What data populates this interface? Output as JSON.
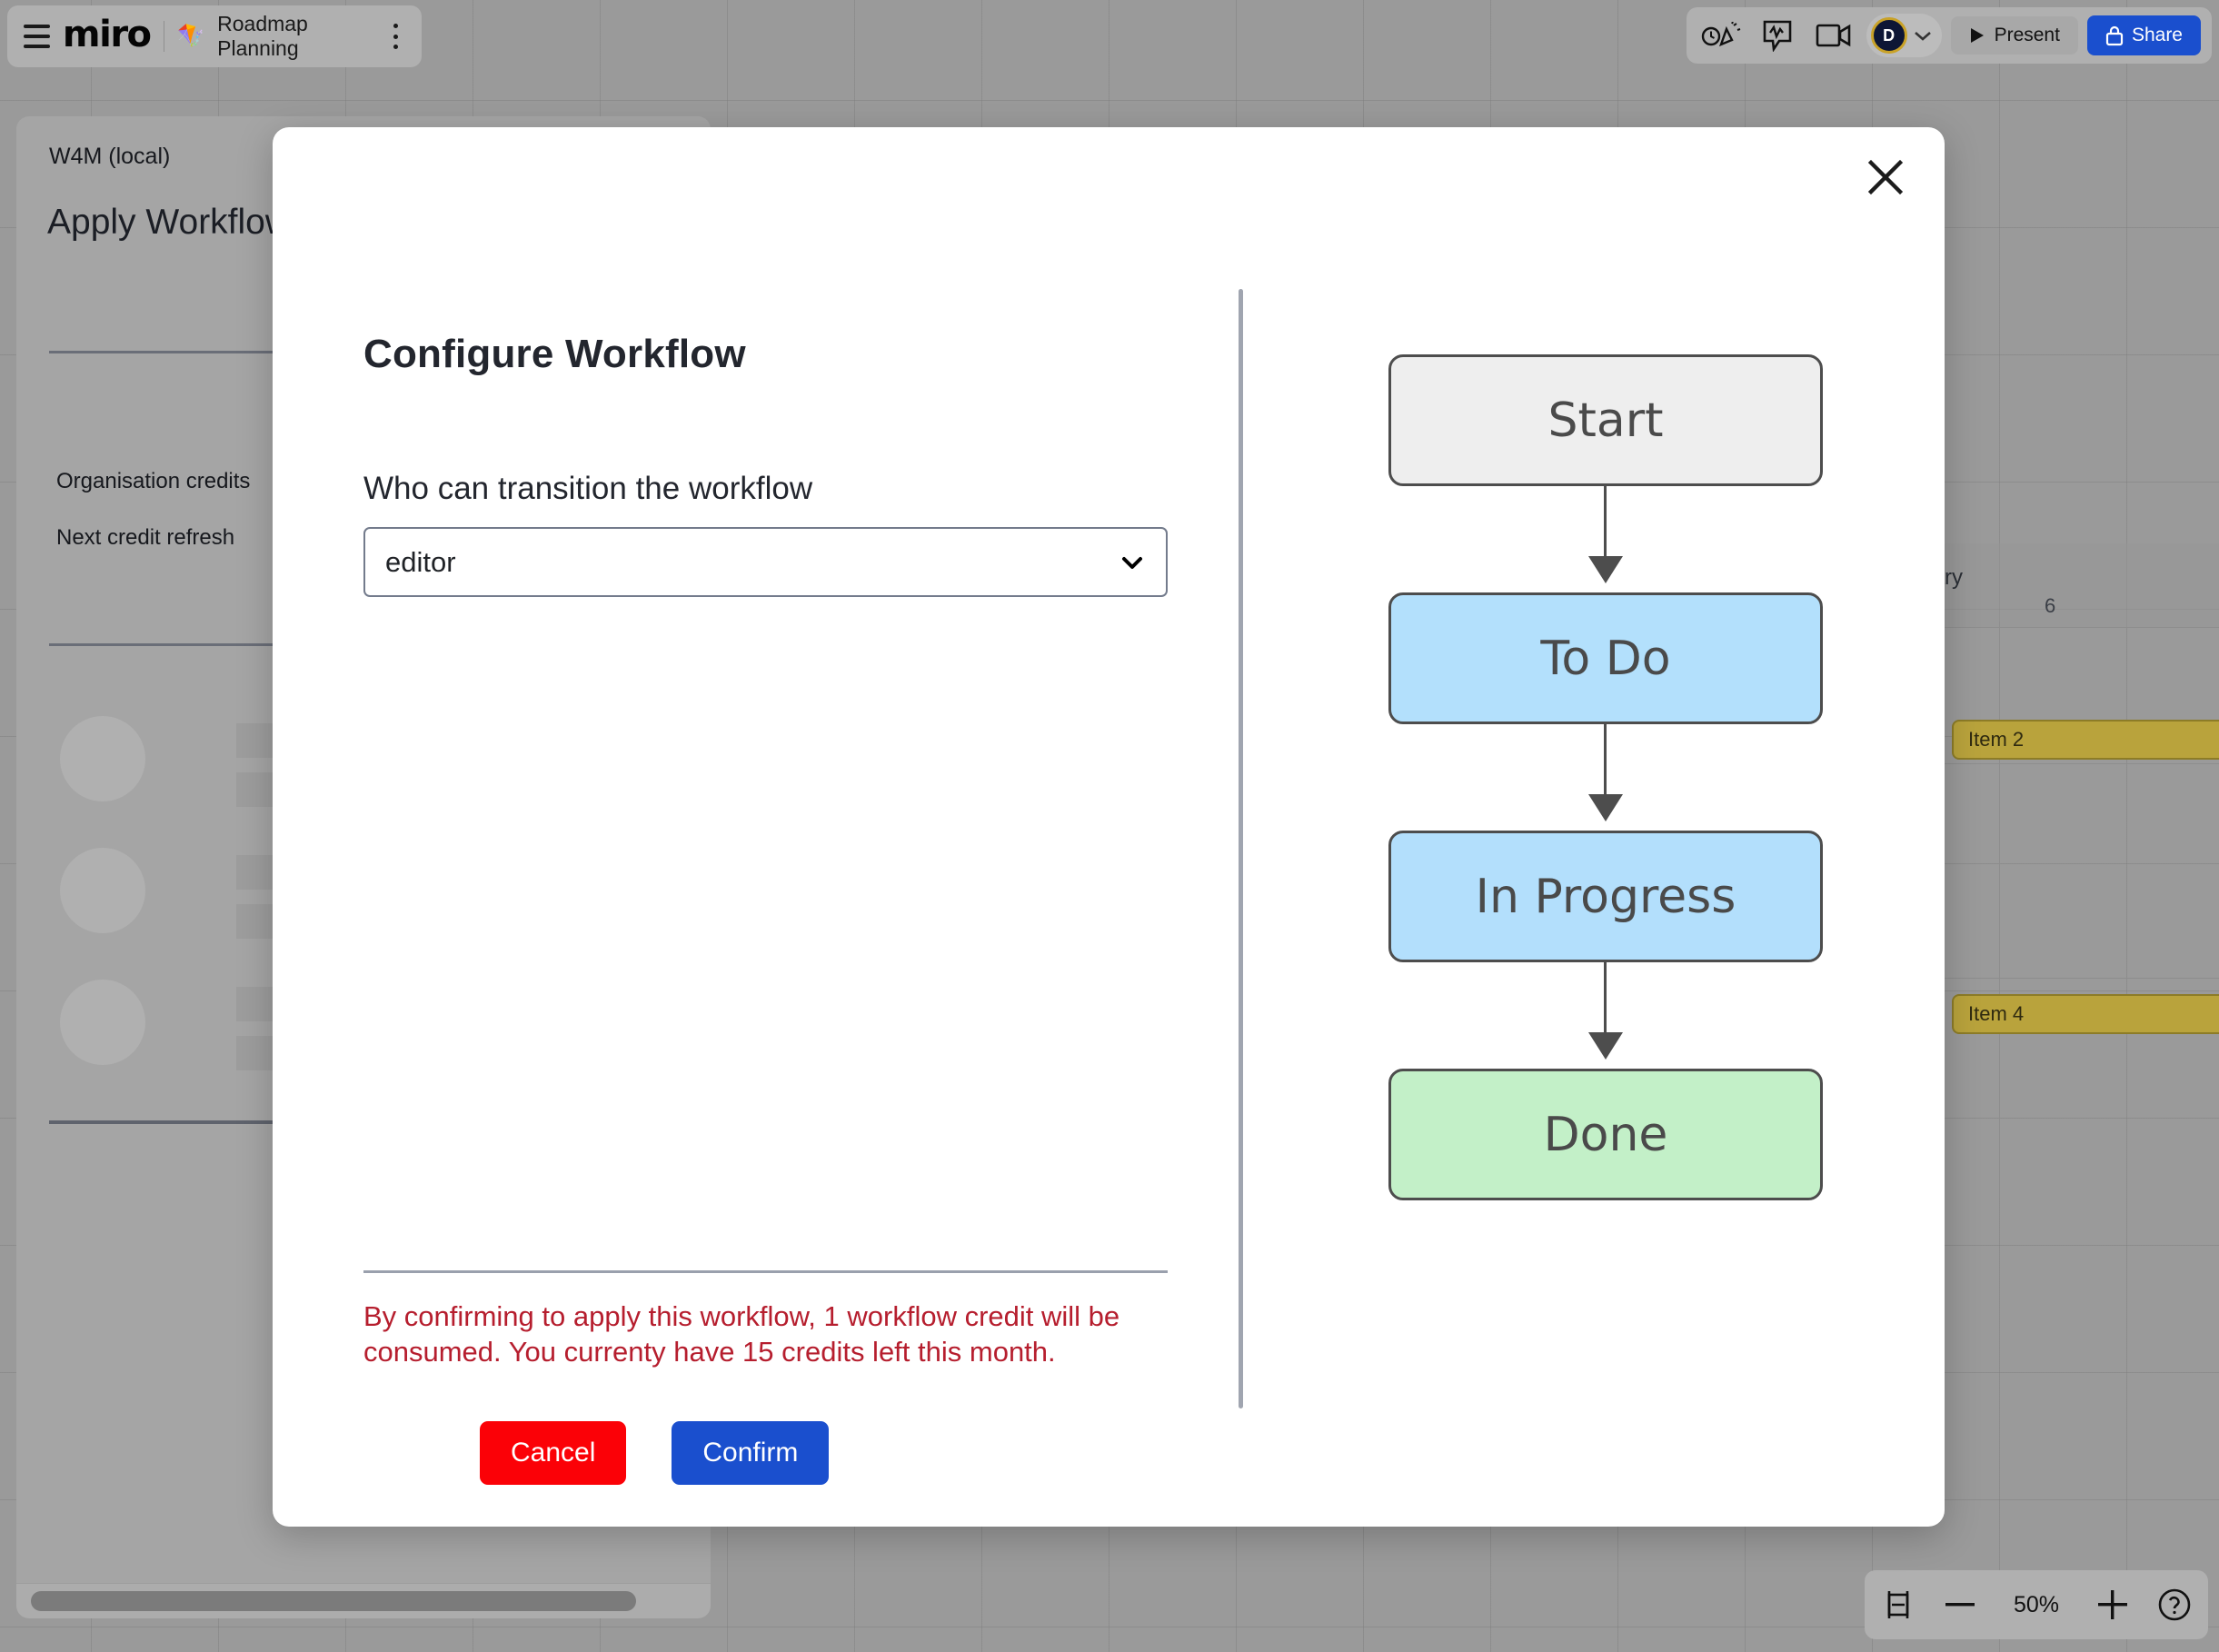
{
  "topbar": {
    "menu_icon": "hamburger-icon",
    "logo_text": "miro",
    "board_emoji": "🪁",
    "board_title": "Roadmap Planning",
    "more_icon": "kebab-menu-icon",
    "right_icons": [
      "timer-confetti-icon",
      "comment-activity-icon",
      "video-call-icon"
    ],
    "avatar_initial": "D",
    "avatar_chevron": "chevron-down-icon",
    "present_label": "Present",
    "present_icon": "play-icon",
    "share_label": "Share",
    "share_icon": "lock-icon"
  },
  "left_panel": {
    "subtitle": "W4M (local)",
    "title": "Apply Workflow",
    "line1": "Organisation credits",
    "line2": "Next credit refresh",
    "skeleton_rows": 3
  },
  "timeline": {
    "month": "nuary",
    "day": "6",
    "items": [
      {
        "label": "Item 2"
      },
      {
        "label": "Item 4"
      }
    ]
  },
  "zoombar": {
    "fit_icon": "fit-to-screen-icon",
    "zoom_out_icon": "minus-icon",
    "zoom_level": "50%",
    "zoom_in_icon": "plus-icon",
    "help_icon": "help-circle-icon"
  },
  "modal": {
    "close_icon": "close-icon",
    "title": "Configure Workflow",
    "field_label": "Who can transition the workflow",
    "select": {
      "value": "editor",
      "chevron_icon": "chevron-down-icon",
      "options": [
        "editor"
      ]
    },
    "warning_text": "By confirming to apply this workflow, 1 workflow credit will be consumed. You currenty have 15 credits left this month.",
    "cancel_label": "Cancel",
    "confirm_label": "Confirm",
    "colors": {
      "cancel_bg": "#fb0107",
      "confirm_bg": "#1a4fce",
      "warning": "#b61e2e"
    }
  },
  "workflow_diagram": {
    "nodes": [
      {
        "label": "Start",
        "fill": "#eeeeee",
        "stroke": "#4d4d4d"
      },
      {
        "label": "To Do",
        "fill": "#b3e0fc",
        "stroke": "#4d4d4d"
      },
      {
        "label": "In Progress",
        "fill": "#b3dffc",
        "stroke": "#4d4d4d"
      },
      {
        "label": "Done",
        "fill": "#c3f0c8",
        "stroke": "#4d4d4d"
      }
    ],
    "edges": [
      {
        "from": "Start",
        "to": "To Do"
      },
      {
        "from": "To Do",
        "to": "In Progress"
      },
      {
        "from": "In Progress",
        "to": "Done"
      }
    ]
  }
}
